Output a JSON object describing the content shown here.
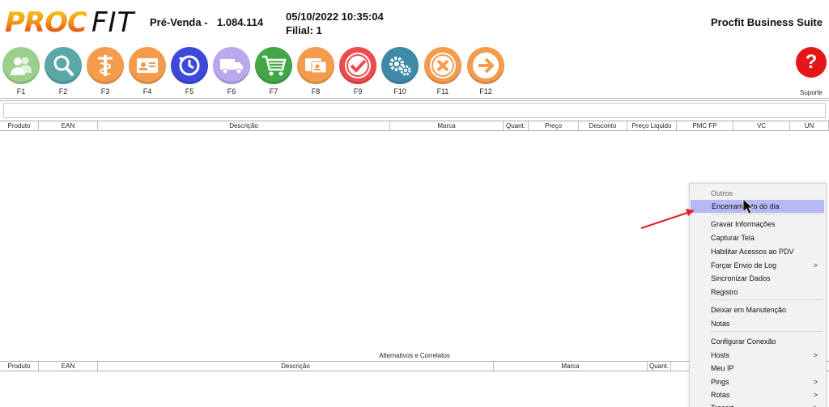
{
  "header": {
    "logo_proc": "PROC",
    "logo_fit": "FIT",
    "mode": "Pré-Venda -",
    "number": "1.084.114",
    "datetime": "05/10/2022 10:35:04",
    "branch": "Filial: 1",
    "suite": "Procfit Business Suite"
  },
  "toolbar": {
    "keys": [
      {
        "label": "F1",
        "icon": "users-icon",
        "color": "#9ccf8c"
      },
      {
        "label": "F2",
        "icon": "search-icon",
        "color": "#5aa7a8"
      },
      {
        "label": "F3",
        "icon": "medical-icon",
        "color": "#f39c4e"
      },
      {
        "label": "F4",
        "icon": "id-card-icon",
        "color": "#f39c4e"
      },
      {
        "label": "F5",
        "icon": "clock-refresh-icon",
        "color": "#3c49d9"
      },
      {
        "label": "F6",
        "icon": "truck-icon",
        "color": "#b9a8ee"
      },
      {
        "label": "F7",
        "icon": "cart-icon",
        "color": "#43a647"
      },
      {
        "label": "F8",
        "icon": "card-icon",
        "color": "#f39c4e"
      },
      {
        "label": "F9",
        "icon": "check-icon",
        "color": "#ec4c4c"
      },
      {
        "label": "F10",
        "icon": "gears-icon",
        "color": "#3e89a8"
      },
      {
        "label": "F11",
        "icon": "close-icon",
        "color": "#f39c4e"
      },
      {
        "label": "F12",
        "icon": "arrow-right-icon",
        "color": "#f39c4e"
      }
    ],
    "support_label": "Suporte",
    "support_glyph": "?"
  },
  "products_table": {
    "columns": [
      "Produto",
      "EAN",
      "Descrição",
      "Marca",
      "Quant.",
      "Preço",
      "Desconto",
      "Preço Liquido",
      "PMC FP",
      "VC",
      "UN"
    ]
  },
  "related_section": {
    "title": "Alternativos e Correlatos",
    "columns": [
      "Produto",
      "EAN",
      "Descrição",
      "Marca",
      "Quant."
    ]
  },
  "context_menu": {
    "items": [
      {
        "label": "Outros",
        "style": "gray"
      },
      {
        "label": "Encerramento do dia",
        "style": "highlight"
      },
      {
        "label": "Gravar Informações"
      },
      {
        "label": "Capturar Tela"
      },
      {
        "label": "Habilitar Acessos ao PDV"
      },
      {
        "label": "Forçar Envio de Log",
        "submenu": ">"
      },
      {
        "label": "Sincronizar Dados"
      },
      {
        "label": "Registro"
      },
      {
        "label": "Deixar em Manutenção"
      },
      {
        "label": "Notas"
      },
      {
        "label": "Configurar Conexão"
      },
      {
        "label": "Hosts",
        "submenu": ">"
      },
      {
        "label": "Meu IP"
      },
      {
        "label": "Pings",
        "submenu": ">"
      },
      {
        "label": "Rotas",
        "submenu": ">"
      },
      {
        "label": "Tracert",
        "submenu": ">"
      }
    ]
  },
  "colors": {
    "highlight": "#b7b9f7",
    "annotation_arrow": "#e02020"
  }
}
